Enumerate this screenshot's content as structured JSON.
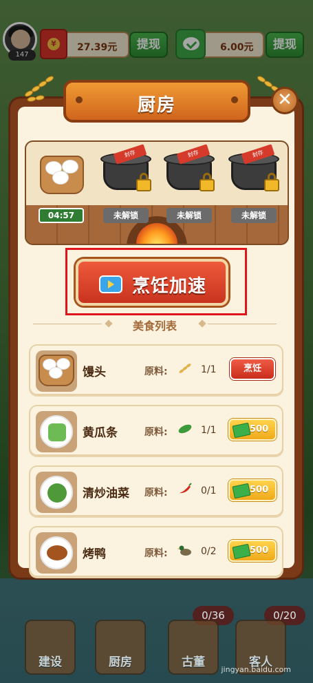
{
  "top_bar": {
    "level": "147",
    "cash_value": "27.39元",
    "withdraw_label_1": "提现",
    "wechat_value": "6.00元",
    "withdraw_label_2": "提现"
  },
  "dialog": {
    "title": "厨房",
    "close_glyph": "✕"
  },
  "cooking_slots": [
    {
      "state": "cooking",
      "label": "04:57"
    },
    {
      "state": "locked",
      "label": "未解锁",
      "seal": "封存"
    },
    {
      "state": "locked",
      "label": "未解锁",
      "seal": "封存"
    },
    {
      "state": "locked",
      "label": "未解锁",
      "seal": "封存"
    }
  ],
  "speedup_button": {
    "label": "烹饪加速"
  },
  "list_title": "美食列表",
  "recipes": [
    {
      "name": "馒头",
      "material_label": "原料:",
      "material_icon": "wheat-icon",
      "qty": "1/1",
      "action": "烹饪"
    },
    {
      "name": "黄瓜条",
      "material_label": "原料:",
      "material_icon": "cucumber-icon",
      "qty": "1/1",
      "price": "500"
    },
    {
      "name": "清炒油菜",
      "material_label": "原料:",
      "material_icon": "chili-icon",
      "qty": "0/1",
      "price": "500"
    },
    {
      "name": "烤鸭",
      "material_label": "原料:",
      "material_icon": "duck-icon",
      "qty": "0/2",
      "price": "500"
    }
  ],
  "bottom_nav": [
    {
      "label": "建设"
    },
    {
      "label": "厨房"
    },
    {
      "label": "古董",
      "badge": "0/36"
    },
    {
      "label": "客人",
      "badge": "0/20"
    }
  ],
  "watermark": "jingyan.baidu.com",
  "colors": {
    "panel_brown": "#7a3a17",
    "panel_cream": "#fbf3df",
    "accent_red": "#e0141b",
    "cook_red": "#c92d1b",
    "price_gold": "#f0a91b"
  }
}
